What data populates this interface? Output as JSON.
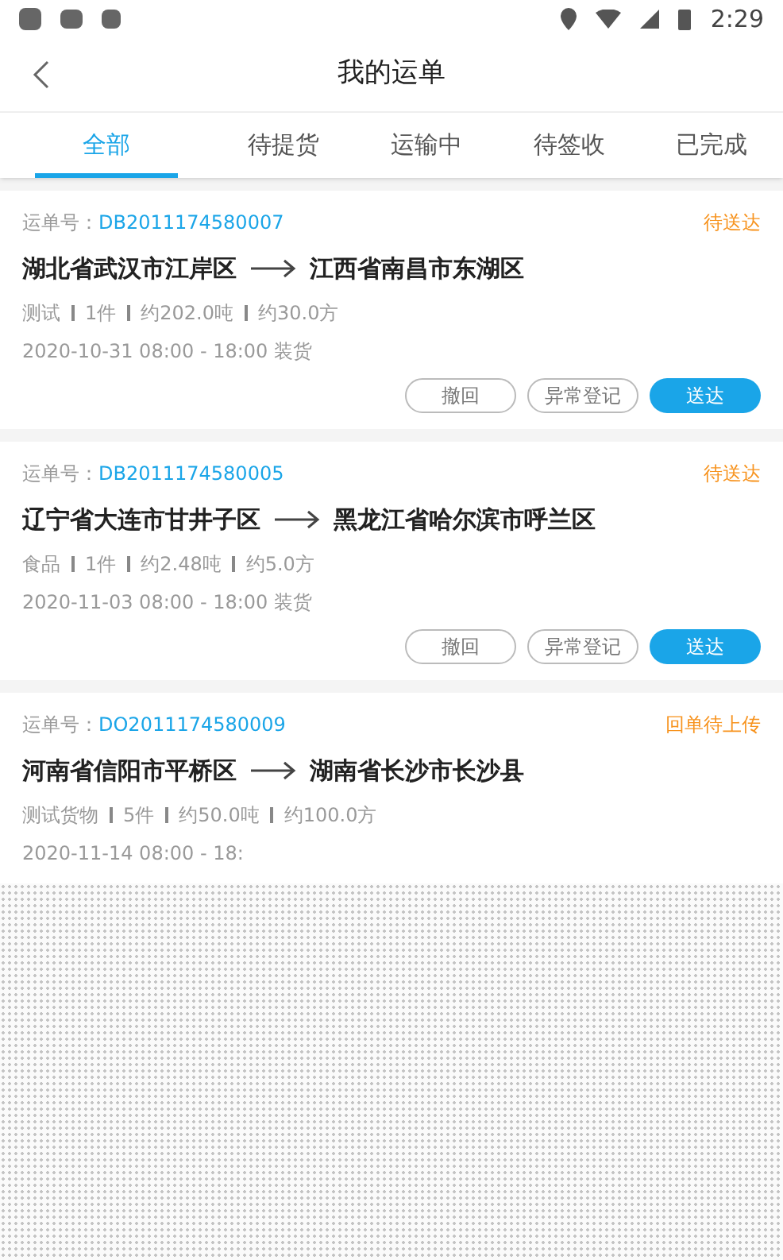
{
  "status_bar": {
    "time": "2:29"
  },
  "header": {
    "title": "我的运单"
  },
  "tabs": [
    {
      "label": "全部",
      "selected": true
    },
    {
      "label": "待提货",
      "selected": false
    },
    {
      "label": "运输中",
      "selected": false
    },
    {
      "label": "待签收",
      "selected": false
    },
    {
      "label": "已完成",
      "selected": false
    }
  ],
  "orders": [
    {
      "number_label": "运单号：",
      "number": "DB2011174580007",
      "status": "待送达",
      "from": "湖北省武汉市江岸区",
      "to": "江西省南昌市东湖区",
      "details": [
        "测试",
        "1件",
        "约202.0吨",
        "约30.0方"
      ],
      "date": "2020-10-31 08:00 - 18:00 装货",
      "buttons": [
        {
          "label": "撤回",
          "kind": "outline"
        },
        {
          "label": "异常登记",
          "kind": "outline"
        },
        {
          "label": "送达",
          "kind": "primary"
        }
      ]
    },
    {
      "number_label": "运单号：",
      "number": "DB2011174580005",
      "status": "待送达",
      "from": "辽宁省大连市甘井子区",
      "to": "黑龙江省哈尔滨市呼兰区",
      "details": [
        "食品",
        "1件",
        "约2.48吨",
        "约5.0方"
      ],
      "date": "2020-11-03 08:00 - 18:00 装货",
      "buttons": [
        {
          "label": "撤回",
          "kind": "outline"
        },
        {
          "label": "异常登记",
          "kind": "outline"
        },
        {
          "label": "送达",
          "kind": "primary"
        }
      ]
    },
    {
      "number_label": "运单号：",
      "number": "DO2011174580009",
      "status": "回单待上传",
      "from": "河南省信阳市平桥区",
      "to": "湖南省长沙市长沙县",
      "details": [
        "测试货物",
        "5件",
        "约50.0吨",
        "约100.0方"
      ],
      "date": "2020-11-14 08:00 - 18:"
    }
  ]
}
